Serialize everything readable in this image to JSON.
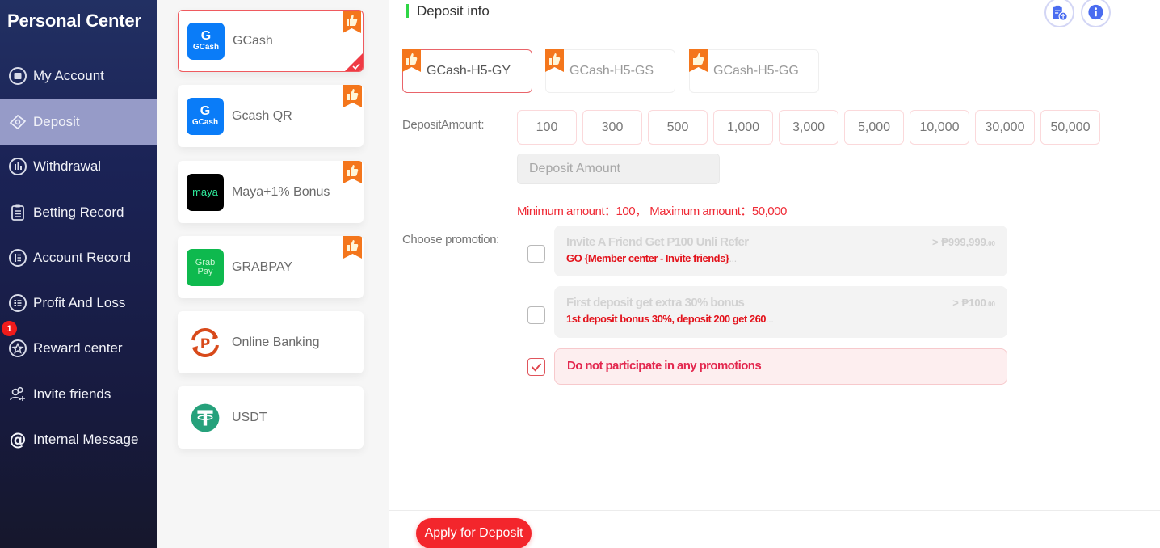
{
  "sidebar": {
    "title": "Personal Center",
    "items": [
      {
        "label": "My Account",
        "icon": "wallet-icon"
      },
      {
        "label": "Deposit",
        "icon": "money-icon",
        "active": true
      },
      {
        "label": "Withdrawal",
        "icon": "chart-bars-icon"
      },
      {
        "label": "Betting Record",
        "icon": "clipboard-icon"
      },
      {
        "label": "Account Record",
        "icon": "list-circle-icon"
      },
      {
        "label": "Profit And Loss",
        "icon": "list-icon"
      },
      {
        "label": "Reward center",
        "icon": "star-badge-icon",
        "badge": "1"
      },
      {
        "label": "Invite friends",
        "icon": "users-add-icon"
      },
      {
        "label": "Internal Message",
        "icon": "at-icon"
      }
    ]
  },
  "methods": [
    {
      "name": "GCash",
      "logo": "gcash-logo",
      "logo_text": [
        "G",
        "GCash"
      ],
      "recommended": true,
      "selected": true
    },
    {
      "name": "Gcash QR",
      "logo": "gcash-logo",
      "logo_text": [
        "G",
        "GCash"
      ],
      "recommended": true
    },
    {
      "name": "Maya+1% Bonus",
      "logo": "maya-logo",
      "logo_text": [
        "maya"
      ],
      "recommended": true
    },
    {
      "name": "GRABPAY",
      "logo": "grabpay-logo",
      "logo_text": [
        "Grab",
        "Pay"
      ],
      "recommended": true
    },
    {
      "name": "Online Banking",
      "logo": "online-banking-logo",
      "recommended": false
    },
    {
      "name": "USDT",
      "logo": "usdt-logo",
      "recommended": false
    }
  ],
  "main": {
    "header_title": "Deposit info",
    "header_icons": [
      "clipboard-upload-icon",
      "info-chat-icon"
    ],
    "channels": [
      {
        "label": "GCash-H5-GY",
        "selected": true
      },
      {
        "label": "GCash-H5-GS"
      },
      {
        "label": "GCash-H5-GG"
      }
    ],
    "amount_label": "DepositAmount:",
    "amounts": [
      "100",
      "300",
      "500",
      "1,000",
      "3,000",
      "5,000",
      "10,000",
      "30,000",
      "50,000"
    ],
    "amount_input": {
      "value": "",
      "placeholder": "Deposit Amount"
    },
    "limits_text": "Minimum amount：100， Maximum amount：50,000",
    "promotion_label": "Choose promotion:",
    "promotions": [
      {
        "title": "Invite A Friend Get P100 Unli Refer",
        "desc": "GO {Member center - Invite friends}",
        "ellipsis": "...",
        "amount": "> ₱999,999",
        "amount_dec": ".00",
        "checked": false
      },
      {
        "title": "First deposit get extra 30% bonus",
        "desc": "1st deposit bonus 30%, deposit 200 get 260",
        "ellipsis": "...",
        "amount": "> ₱100",
        "amount_dec": ".00",
        "checked": false
      },
      {
        "title": "Do not participate in any promotions",
        "checked": true
      }
    ],
    "apply_label": "Apply for Deposit"
  },
  "colors": {
    "accent_red": "#f3262c",
    "sidebar_active": "#969bc8",
    "header_bar_green": "#2fd646",
    "icon_blue": "#4a6cf0"
  }
}
